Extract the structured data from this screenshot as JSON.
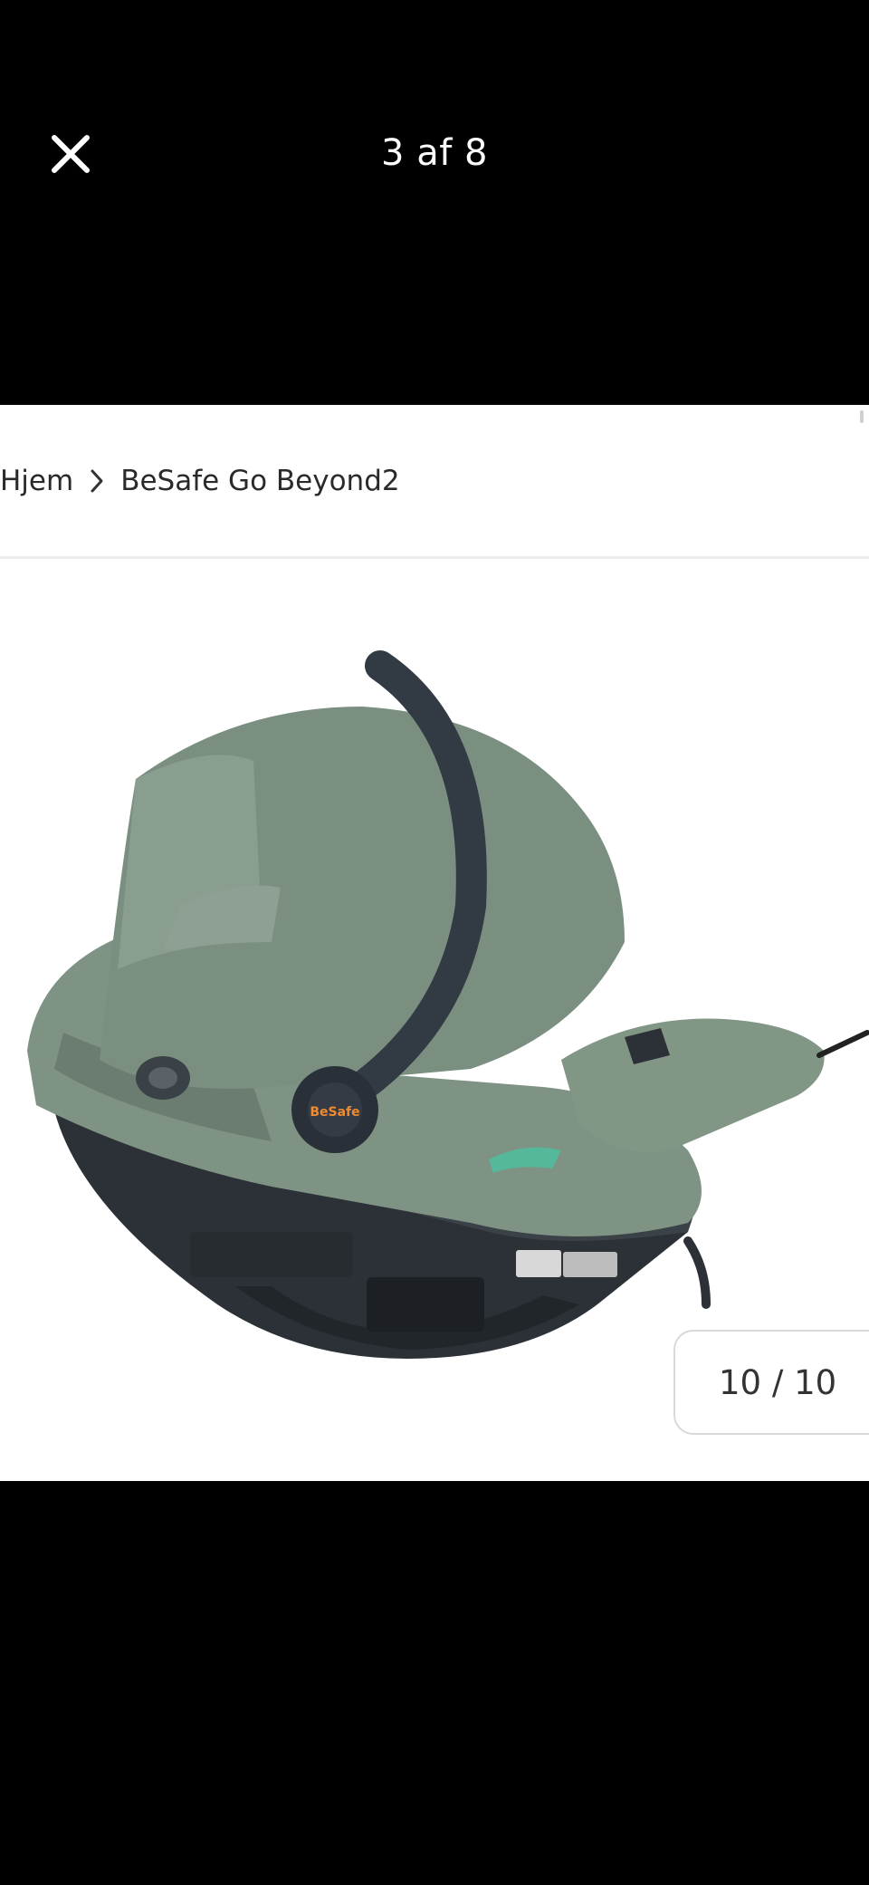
{
  "viewer": {
    "counter": "3 af 8",
    "close_icon": "close-icon"
  },
  "breadcrumb": {
    "home": "Hjem",
    "separator_icon": "chevron-right-icon",
    "current": "BeSafe Go Beyond2"
  },
  "product": {
    "logo_text": "BeSafe",
    "colors": {
      "fabric": "#7e9383",
      "shell": "#2b3136",
      "handle": "#323a44",
      "accent": "#56b89a"
    }
  },
  "gallery": {
    "pager": "10 / 10"
  }
}
